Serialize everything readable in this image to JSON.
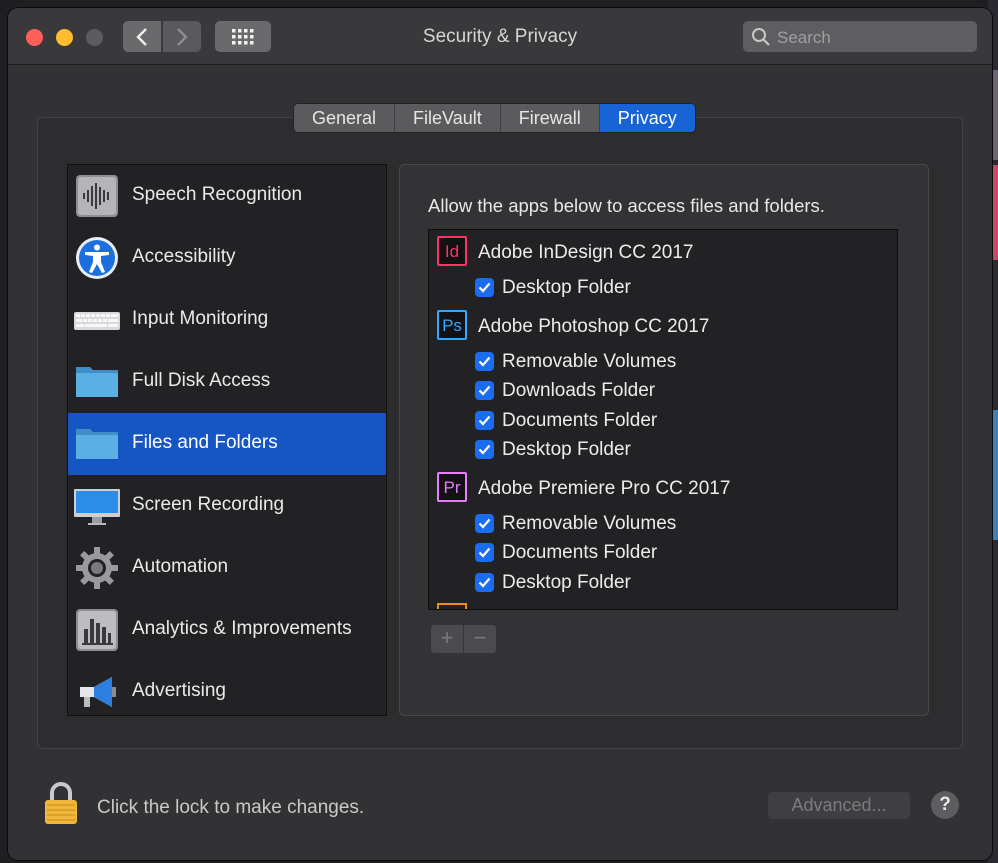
{
  "window": {
    "title": "Security & Privacy"
  },
  "search": {
    "placeholder": "Search"
  },
  "tabs": [
    {
      "label": "General"
    },
    {
      "label": "FileVault"
    },
    {
      "label": "Firewall"
    },
    {
      "label": "Privacy",
      "active": true
    }
  ],
  "sidebar": {
    "items": [
      {
        "label": "Speech Recognition",
        "icon": "waveform-icon"
      },
      {
        "label": "Accessibility",
        "icon": "accessibility-icon"
      },
      {
        "label": "Input Monitoring",
        "icon": "keyboard-icon"
      },
      {
        "label": "Full Disk Access",
        "icon": "folder-icon"
      },
      {
        "label": "Files and Folders",
        "icon": "folder-icon",
        "selected": true
      },
      {
        "label": "Screen Recording",
        "icon": "display-icon"
      },
      {
        "label": "Automation",
        "icon": "gear-icon"
      },
      {
        "label": "Analytics & Improvements",
        "icon": "bar-chart-icon"
      },
      {
        "label": "Advertising",
        "icon": "megaphone-icon"
      }
    ]
  },
  "main": {
    "description": "Allow the apps below to access files and folders.",
    "apps": [
      {
        "name": "Adobe InDesign CC 2017",
        "badge": "Id",
        "color": "#ff3366",
        "permissions": [
          {
            "label": "Desktop Folder",
            "checked": true
          }
        ]
      },
      {
        "name": "Adobe Photoshop CC 2017",
        "badge": "Ps",
        "color": "#31a8ff",
        "permissions": [
          {
            "label": "Removable Volumes",
            "checked": true
          },
          {
            "label": "Downloads Folder",
            "checked": true
          },
          {
            "label": "Documents Folder",
            "checked": true
          },
          {
            "label": "Desktop Folder",
            "checked": true
          }
        ]
      },
      {
        "name": "Adobe Premiere Pro CC 2017",
        "badge": "Pr",
        "color": "#e77cff",
        "permissions": [
          {
            "label": "Removable Volumes",
            "checked": true
          },
          {
            "label": "Documents Folder",
            "checked": true
          },
          {
            "label": "Desktop Folder",
            "checked": true
          }
        ]
      }
    ],
    "add_label": "+",
    "remove_label": "−"
  },
  "footer": {
    "lock_text": "Click the lock to make changes.",
    "advanced_label": "Advanced...",
    "help_label": "?"
  },
  "colors": {
    "accent": "#1863d6",
    "selected_row": "#1555c4",
    "checkbox": "#1a6cf0"
  }
}
